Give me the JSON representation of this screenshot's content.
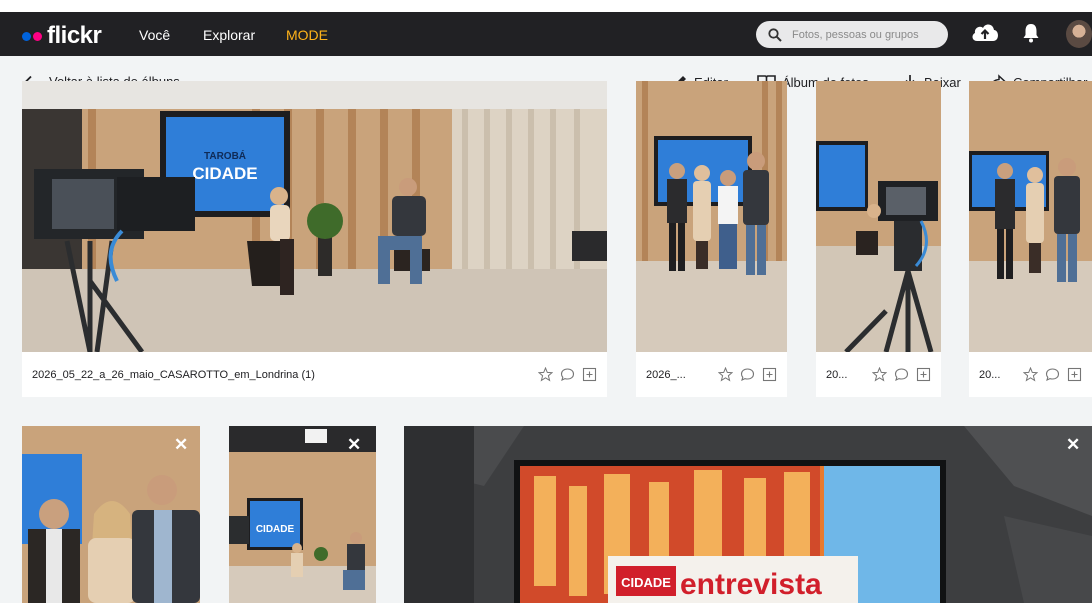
{
  "app": {
    "logo_text": "flickr",
    "colors": {
      "brand_blue": "#0063dc",
      "brand_pink": "#ff0084",
      "mode": "#ffb319",
      "topbar": "#212124"
    }
  },
  "nav": {
    "voce": "Você",
    "explorar": "Explorar",
    "mode": "MODE"
  },
  "search": {
    "placeholder": "Fotos, pessoas ou grupos",
    "icon": "search-icon"
  },
  "header_icons": [
    "upload-cloud-icon",
    "bell-icon",
    "avatar"
  ],
  "toolbar": {
    "back_label": "Voltar à lista de álbuns",
    "edit_label": "Editar",
    "album_label": "Álbum de fotos",
    "download_label": "Baixar",
    "share_label": "Compartilhar"
  },
  "photos": [
    {
      "title": "2026_05_22_a_26_maio_CASAROTTO_em_Londrina (1)"
    },
    {
      "title": "2026_..."
    },
    {
      "title": "20..."
    },
    {
      "title": "20..."
    }
  ],
  "tv": {
    "taroba_line1": "TAROBÁ",
    "taroba_line2": "CIDADE",
    "entrevista_tag": "CIDADE",
    "entrevista_word": "entrevista"
  }
}
